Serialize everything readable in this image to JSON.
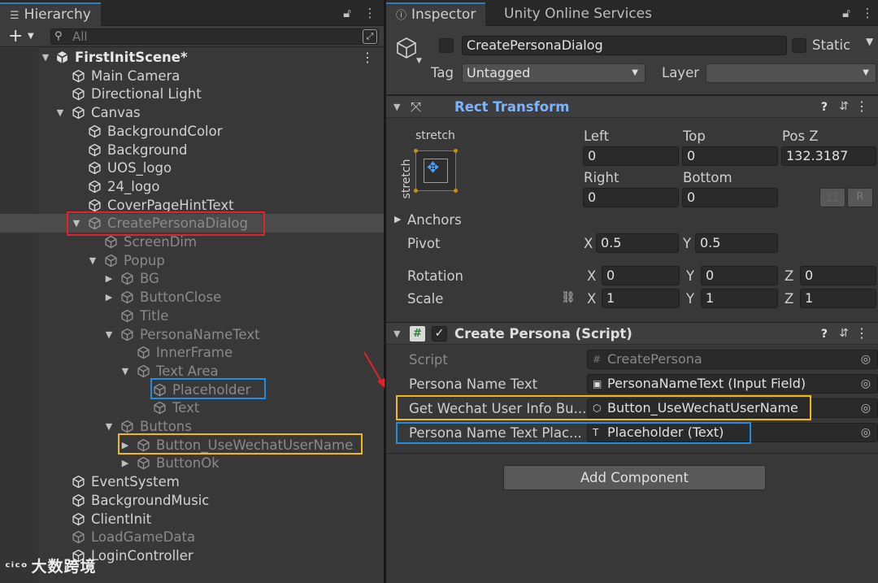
{
  "hierarchy": {
    "tab_label": "Hierarchy",
    "search_placeholder": "All",
    "scene_name": "FirstInitScene*",
    "items": [
      {
        "label": "Main Camera"
      },
      {
        "label": "Directional Light"
      },
      {
        "label": "Canvas"
      },
      {
        "label": "BackgroundColor"
      },
      {
        "label": "Background"
      },
      {
        "label": "UOS_logo"
      },
      {
        "label": "24_logo"
      },
      {
        "label": "CoverPageHintText"
      },
      {
        "label": "CreatePersonaDialog"
      },
      {
        "label": "ScreenDim"
      },
      {
        "label": "Popup"
      },
      {
        "label": "BG"
      },
      {
        "label": "ButtonClose"
      },
      {
        "label": "Title"
      },
      {
        "label": "PersonaNameText"
      },
      {
        "label": "InnerFrame"
      },
      {
        "label": "Text Area"
      },
      {
        "label": "Placeholder"
      },
      {
        "label": "Text"
      },
      {
        "label": "Buttons"
      },
      {
        "label": "Button_UseWechatUserName"
      },
      {
        "label": "ButtonOk"
      },
      {
        "label": "EventSystem"
      },
      {
        "label": "BackgroundMusic"
      },
      {
        "label": "ClientInit"
      },
      {
        "label": "LoadGameData"
      },
      {
        "label": "LoginController"
      }
    ]
  },
  "inspector": {
    "tab_label": "Inspector",
    "services_tab_label": "Unity Online Services",
    "object_name": "CreatePersonaDialog",
    "static_label": "Static",
    "tag_label": "Tag",
    "tag_value": "Untagged",
    "layer_label": "Layer",
    "layer_value": "",
    "rect_transform": {
      "title": "Rect Transform",
      "anchor_preset_h": "stretch",
      "anchor_preset_v": "stretch",
      "left_label": "Left",
      "left_value": "0",
      "top_label": "Top",
      "top_value": "0",
      "posz_label": "Pos Z",
      "posz_value": "132.3187",
      "right_label": "Right",
      "right_value": "0",
      "bottom_label": "Bottom",
      "bottom_value": "0",
      "raw_button": "R",
      "anchors_label": "Anchors",
      "pivot_label": "Pivot",
      "pivot_x": "0.5",
      "pivot_y": "0.5",
      "rotation_label": "Rotation",
      "rot_x": "0",
      "rot_y": "0",
      "rot_z": "0",
      "scale_label": "Scale",
      "scale_x": "1",
      "scale_y": "1",
      "scale_z": "1",
      "x_label": "X",
      "y_label": "Y",
      "z_label": "Z"
    },
    "script_component": {
      "title": "Create Persona (Script)",
      "script_label": "Script",
      "script_value": "CreatePersona",
      "fields": [
        {
          "label": "Persona Name Text",
          "value": "PersonaNameText (Input Field)"
        },
        {
          "label": "Get Wechat User Info Bu...",
          "value": "Button_UseWechatUserName"
        },
        {
          "label": "Persona Name Text Plac...",
          "value": "Placeholder (Text)"
        }
      ]
    },
    "add_component_label": "Add Component"
  },
  "watermark": "大数跨境",
  "colors": {
    "highlight_red": "#e2242a",
    "highlight_blue": "#1f8de6",
    "highlight_yellow": "#f0b915",
    "accent_blue": "#3a79bb",
    "rect_transform_title": "#7cb5ff"
  }
}
